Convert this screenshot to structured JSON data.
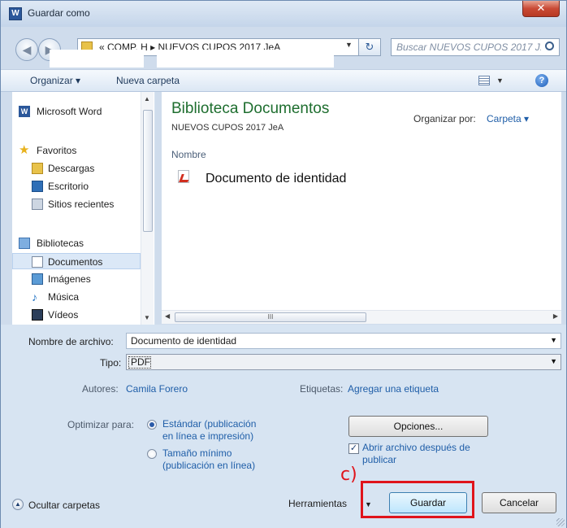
{
  "window": {
    "title": "Guardar como",
    "close_glyph": "✕",
    "word_icon": "W"
  },
  "address": {
    "crumbs": "« COMP. H  ▸  NUEVOS CUPOS 2017 JeA",
    "search_placeholder": "Buscar NUEVOS CUPOS 2017 J...",
    "refresh_glyph": "↻",
    "back_glyph": "◀",
    "forward_glyph": "▶"
  },
  "toolbar": {
    "organize": "Organizar ▾",
    "new_folder": "Nueva carpeta",
    "help": "?"
  },
  "nav": {
    "word": "Microsoft Word",
    "favorites": "Favoritos",
    "downloads": "Descargas",
    "desktop": "Escritorio",
    "recent": "Sitios recientes",
    "libraries": "Bibliotecas",
    "documents": "Documentos",
    "images": "Imágenes",
    "music": "Música",
    "videos": "Vídeos"
  },
  "content": {
    "library_title": "Biblioteca Documentos",
    "library_subtitle": "NUEVOS CUPOS 2017 JeA",
    "organize_by_label": "Organizar por:",
    "organize_by_value": "Carpeta ▾",
    "column_name": "Nombre",
    "files": [
      "Documento de identidad"
    ],
    "hscroll_grip": "III"
  },
  "form": {
    "filename_label": "Nombre de archivo:",
    "filename_value": "Documento de identidad",
    "type_label": "Tipo:",
    "type_value": "PDF",
    "authors_label": "Autores:",
    "authors_value": "Camila Forero",
    "tags_label": "Etiquetas:",
    "tags_value": "Agregar una etiqueta",
    "optimize_label": "Optimizar para:",
    "opt_standard_line1": "Estándar (publicación",
    "opt_standard_line2": "en línea e impresión)",
    "opt_minimum_line1": "Tamaño mínimo",
    "opt_minimum_line2": "(publicación en línea)",
    "options_button": "Opciones...",
    "open_after_line1": "Abrir archivo después de",
    "open_after_line2": "publicar",
    "open_after_checked": true,
    "hide_folders": "Ocultar carpetas",
    "tools": "Herramientas",
    "save_button": "Guardar",
    "cancel_button": "Cancelar"
  },
  "annotation": {
    "label": "c)",
    "color": "#e0141b"
  },
  "colors": {
    "library_title": "#1e6e2f",
    "link": "#1f5ea8",
    "chrome": "#d7e4f2"
  }
}
